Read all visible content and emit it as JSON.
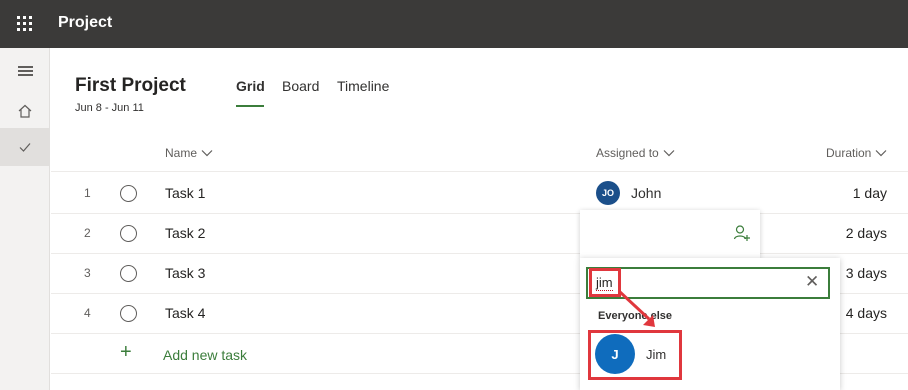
{
  "app": {
    "title": "Project"
  },
  "plan": {
    "title": "First Project",
    "dates": "Jun 8 - Jun 11"
  },
  "tabs": [
    {
      "label": "Grid",
      "active": true
    },
    {
      "label": "Board",
      "active": false
    },
    {
      "label": "Timeline",
      "active": false
    }
  ],
  "columns": {
    "name": "Name",
    "assigned": "Assigned to",
    "duration": "Duration"
  },
  "tasks": [
    {
      "num": "1",
      "name": "Task 1",
      "duration": "1 day"
    },
    {
      "num": "2",
      "name": "Task 2",
      "duration": "2 days"
    },
    {
      "num": "3",
      "name": "Task 3",
      "duration": "3 days"
    },
    {
      "num": "4",
      "name": "Task 4",
      "duration": "4 days"
    }
  ],
  "assignee": {
    "initials": "JO",
    "name": "John"
  },
  "add_task": {
    "label": "Add new task"
  },
  "popup": {
    "search_value": "jim",
    "section_label": "Everyone else",
    "result": {
      "initial": "J",
      "name": "Jim"
    }
  },
  "colors": {
    "topbar": "#3b3a39",
    "accent": "#3b7d3b",
    "john_avatar": "#1b4f8a",
    "jim_avatar": "#0f6cbd",
    "annotation": "#e0373d"
  },
  "icons": [
    "waffle-icon",
    "hamburger-icon",
    "home-icon",
    "check-icon",
    "chevron-down-icon",
    "add-person-icon",
    "close-icon",
    "plus-icon"
  ]
}
